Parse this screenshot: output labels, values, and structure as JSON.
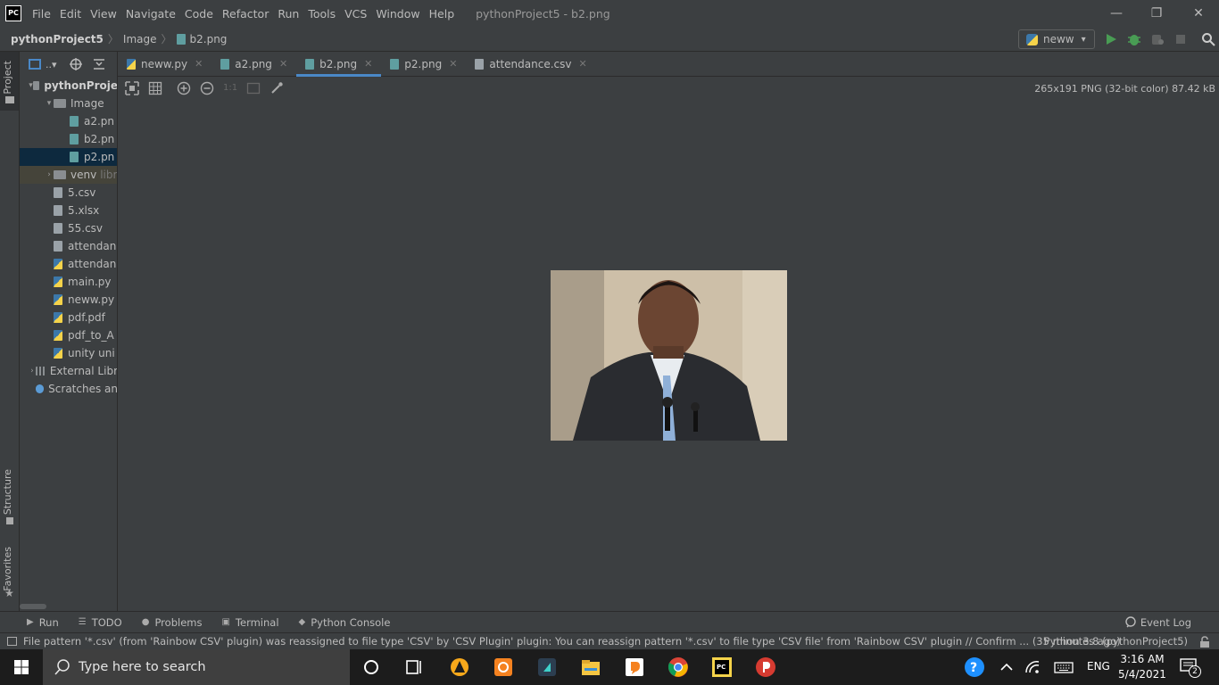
{
  "app": {
    "logo_text": "PC",
    "window_title": "pythonProject5 - b2.png"
  },
  "menu": [
    "File",
    "Edit",
    "View",
    "Navigate",
    "Code",
    "Refactor",
    "Run",
    "Tools",
    "VCS",
    "Window",
    "Help"
  ],
  "window_controls": {
    "minimize": "—",
    "restore": "❐",
    "close": "✕"
  },
  "breadcrumb": {
    "project": "pythonProject5",
    "folder": "Image",
    "file": "b2.png"
  },
  "run_config": {
    "label": "neww",
    "caret": "▾"
  },
  "left_strip": {
    "project": "Project",
    "structure": "Structure",
    "favorites": "Favorites"
  },
  "project_panel": {
    "view_label": "..▾",
    "tree": [
      {
        "label": "pythonProje",
        "type": "folder",
        "chev": "▾",
        "bold": true
      },
      {
        "label": "Image",
        "type": "folder",
        "chev": "▾"
      },
      {
        "label": "a2.pn",
        "type": "img"
      },
      {
        "label": "b2.pn",
        "type": "img"
      },
      {
        "label": "p2.pn",
        "type": "img",
        "selected": true
      },
      {
        "label": "venv",
        "type": "folder",
        "chev": "›",
        "suffix": "libr"
      },
      {
        "label": "5.csv",
        "type": "file"
      },
      {
        "label": "5.xlsx",
        "type": "file"
      },
      {
        "label": "55.csv",
        "type": "file"
      },
      {
        "label": "attendan",
        "type": "file"
      },
      {
        "label": "attendan",
        "type": "py"
      },
      {
        "label": "main.py",
        "type": "py"
      },
      {
        "label": "neww.py",
        "type": "py"
      },
      {
        "label": "pdf.pdf",
        "type": "py"
      },
      {
        "label": "pdf_to_A",
        "type": "py"
      },
      {
        "label": "unity uni",
        "type": "py"
      },
      {
        "label": "External Libr",
        "type": "lib",
        "chev": "›"
      },
      {
        "label": "Scratches an",
        "type": "scratch"
      }
    ]
  },
  "tabs": [
    {
      "label": "neww.py",
      "icon": "py",
      "close": "✕"
    },
    {
      "label": "a2.png",
      "icon": "img",
      "close": "✕"
    },
    {
      "label": "b2.png",
      "icon": "img",
      "close": "✕",
      "active": true
    },
    {
      "label": "p2.png",
      "icon": "img",
      "close": "✕"
    },
    {
      "label": "attendance.csv",
      "icon": "file",
      "close": "✕"
    }
  ],
  "image_toolbar": {
    "zoom_actual": "1:1",
    "info": "265x191 PNG (32-bit color) 87.42 kB"
  },
  "tool_windows": [
    {
      "label": "Run",
      "icon": "▶"
    },
    {
      "label": "TODO",
      "icon": "☰"
    },
    {
      "label": "Problems",
      "icon": "●"
    },
    {
      "label": "Terminal",
      "icon": "▣"
    },
    {
      "label": "Python Console",
      "icon": "◆"
    }
  ],
  "event_log": "Event Log",
  "status": {
    "message": "File pattern '*.csv' (from 'Rainbow CSV' plugin) was reassigned to file type 'CSV' by 'CSV Plugin' plugin: You can reassign pattern '*.csv' to file type 'CSV file' from 'Rainbow CSV' plugin // Confirm ... (35 minutes ago)",
    "interpreter": "Python 3.8 (pythonProject5)"
  },
  "taskbar": {
    "search_placeholder": "Type here to search",
    "language": "ENG",
    "time": "3:16 AM",
    "date": "5/4/2021",
    "notification_count": "2",
    "colors": {
      "taskbar": "#1c1c1c",
      "search": "#3f3f3f",
      "accent": "#76b9ed"
    }
  }
}
